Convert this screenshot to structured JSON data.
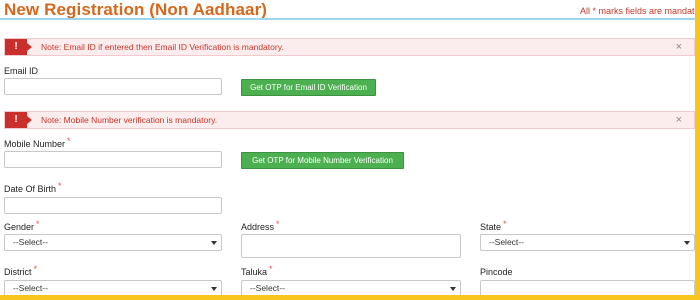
{
  "header": {
    "title": "New Registration (Non Aadhaar)",
    "mandatory_note": "All * marks fields are mandatory"
  },
  "alerts": {
    "email": {
      "badge": "!",
      "message": "Note: Email ID if entered then Email ID Verification is mandatory.",
      "close": "×"
    },
    "mobile": {
      "badge": "!",
      "message": "Note: Mobile Number verification is mandatory.",
      "close": "×"
    }
  },
  "required_marker": "*",
  "form": {
    "email": {
      "label": "Email ID",
      "value": "",
      "button": "Get OTP for Email ID Verification"
    },
    "mobile": {
      "label": "Mobile Number",
      "value": "",
      "button": "Get OTP for Mobile Number Verification"
    },
    "dob": {
      "label": "Date Of Birth",
      "value": ""
    },
    "gender": {
      "label": "Gender",
      "selected": "--Select--"
    },
    "address": {
      "label": "Address",
      "value": ""
    },
    "state": {
      "label": "State",
      "selected": "--Select--"
    },
    "district": {
      "label": "District",
      "selected": "--Select--"
    },
    "taluka": {
      "label": "Taluka",
      "selected": "--Select--"
    },
    "pincode": {
      "label": "Pincode",
      "value": ""
    }
  },
  "colors": {
    "frame": "#f7c51e",
    "title": "#d4691e",
    "alert_badge": "#c9302c",
    "button": "#4caf50"
  }
}
